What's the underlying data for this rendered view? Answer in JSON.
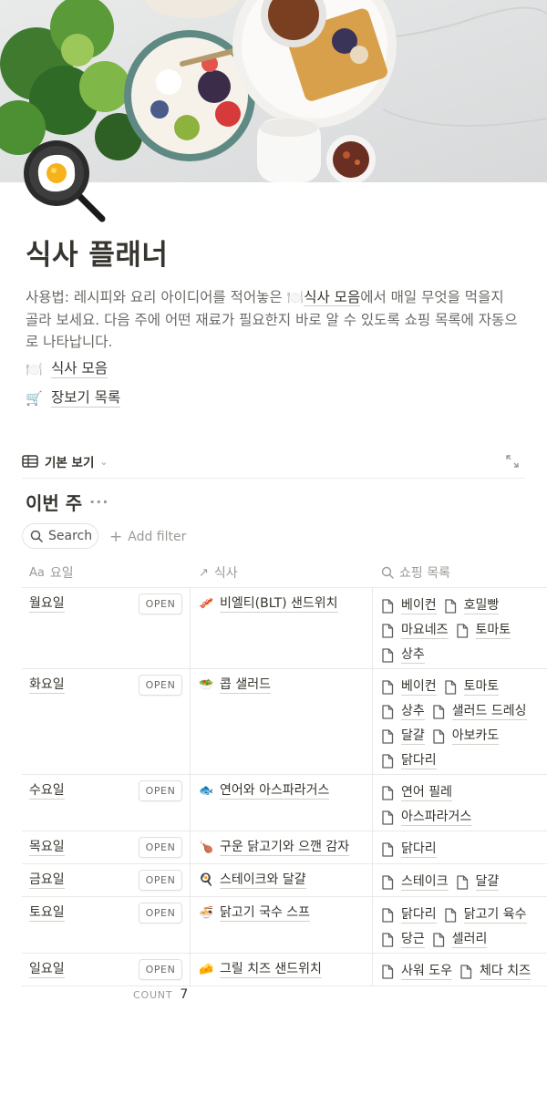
{
  "page": {
    "icon": "frying-pan-egg-icon",
    "title": "식사 플래너",
    "description_pre": "사용법: 레시피와 요리 아이디어를 적어놓은 ",
    "description_link_emoji": "🍽️",
    "description_link": "식사 모음",
    "description_post": "에서 매일 무엇을 먹을지 골라 보세요. 다음 주에 어떤 재료가 필요한지 바로 알 수 있도록 쇼핑 목록에 자동으로 나타납니다.",
    "links": [
      {
        "emoji": "🍽️",
        "label": "식사 모음"
      },
      {
        "emoji": "🛒",
        "label": "장보기 목록"
      }
    ]
  },
  "view": {
    "label": "기본 보기",
    "icon": "table-icon"
  },
  "database": {
    "title": "이번 주",
    "search_label": "Search",
    "add_filter_label": "Add filter",
    "columns": [
      {
        "icon": "Aa",
        "label": "요일"
      },
      {
        "icon": "↗",
        "label": "식사"
      },
      {
        "icon": "search-icon",
        "label": "쇼핑 목록"
      }
    ],
    "open_label": "OPEN",
    "rows": [
      {
        "day": "월요일",
        "meal_emoji": "🥓",
        "meal": "비엘티(BLT) 샌드위치",
        "items": [
          "베이컨",
          "호밀빵",
          "마요네즈",
          "토마토",
          "상추"
        ]
      },
      {
        "day": "화요일",
        "meal_emoji": "🥗",
        "meal": "콥 샐러드",
        "items": [
          "베이컨",
          "토마토",
          "상추",
          "샐러드 드레싱",
          "달걀",
          "아보카도",
          "닭다리"
        ]
      },
      {
        "day": "수요일",
        "meal_emoji": "🐟",
        "meal": "연어와 아스파라거스",
        "items": [
          "연어 필레",
          "아스파라거스"
        ]
      },
      {
        "day": "목요일",
        "meal_emoji": "🍗",
        "meal": "구운 닭고기와 으깬 감자",
        "items": [
          "닭다리"
        ]
      },
      {
        "day": "금요일",
        "meal_emoji": "🍳",
        "meal": "스테이크와 달걀",
        "items": [
          "스테이크",
          "달걀"
        ]
      },
      {
        "day": "토요일",
        "meal_emoji": "🍜",
        "meal": "닭고기 국수 스프",
        "items": [
          "닭다리",
          "닭고기 육수",
          "당근",
          "셀러리"
        ]
      },
      {
        "day": "일요일",
        "meal_emoji": "🧀",
        "meal": "그릴 치즈 샌드위치",
        "items": [
          "사워 도우",
          "체다 치즈"
        ]
      }
    ],
    "count_label": "COUNT",
    "count_value": "7"
  }
}
